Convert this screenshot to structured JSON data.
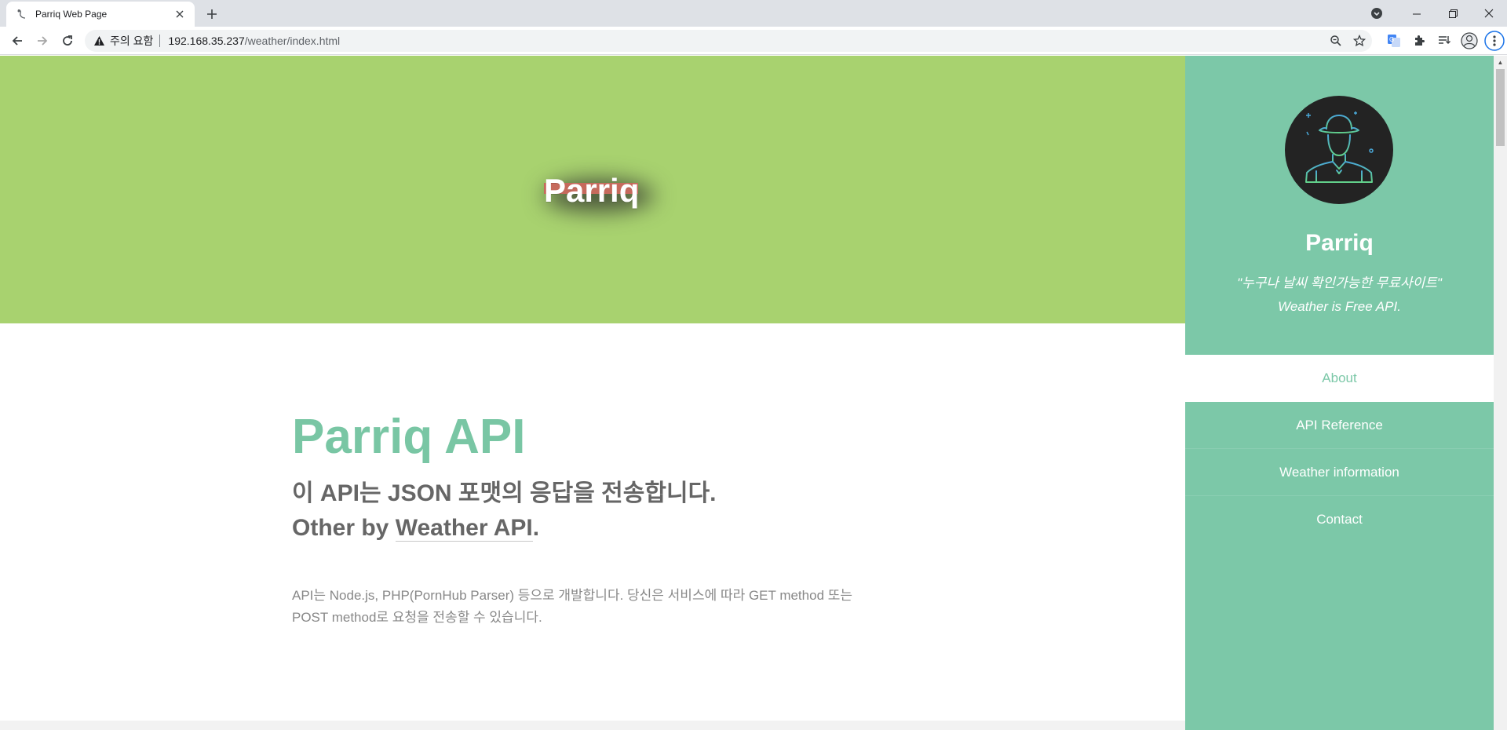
{
  "browser": {
    "tab_title": "Parriq Web Page",
    "security_label": "주의 요함",
    "url_host": "192.168.35.237",
    "url_path": "/weather/index.html"
  },
  "hero": {
    "logo_text": "Parriq"
  },
  "main": {
    "title": "Parriq API",
    "subtitle_line1": "이 API는 JSON 포맷의 응답을 전송합니다.",
    "subtitle_prefix": "Other by ",
    "subtitle_link": "Weather API",
    "subtitle_suffix": ".",
    "body": "API는 Node.js, PHP(PornHub Parser) 등으로 개발합니다. 당신은 서비스에 따라 GET method 또는 POST method로 요청을 전송할 수 있습니다."
  },
  "sidebar": {
    "name": "Parriq",
    "quote_line1": "\"누구나 날씨 확인가능한 무료사이트\"",
    "quote_line2": "Weather is Free API.",
    "nav": [
      {
        "label": "About",
        "active": true
      },
      {
        "label": "API Reference",
        "active": false
      },
      {
        "label": "Weather information",
        "active": false
      },
      {
        "label": "Contact",
        "active": false
      }
    ]
  },
  "colors": {
    "hero_bg": "#a8d26f",
    "sidebar_bg": "#7cc8a8",
    "accent_title": "#79c6a4",
    "logo_bar": "#c66a5c"
  },
  "icons": [
    "favicon-icon",
    "close-icon",
    "plus-icon",
    "tab-search-icon",
    "minimize-icon",
    "restore-icon",
    "window-close-icon",
    "back-icon",
    "forward-icon",
    "reload-icon",
    "warning-icon",
    "zoom-icon",
    "star-icon",
    "translate-icon",
    "extensions-icon",
    "reading-list-icon",
    "profile-icon",
    "menu-icon",
    "avatar-icon"
  ]
}
